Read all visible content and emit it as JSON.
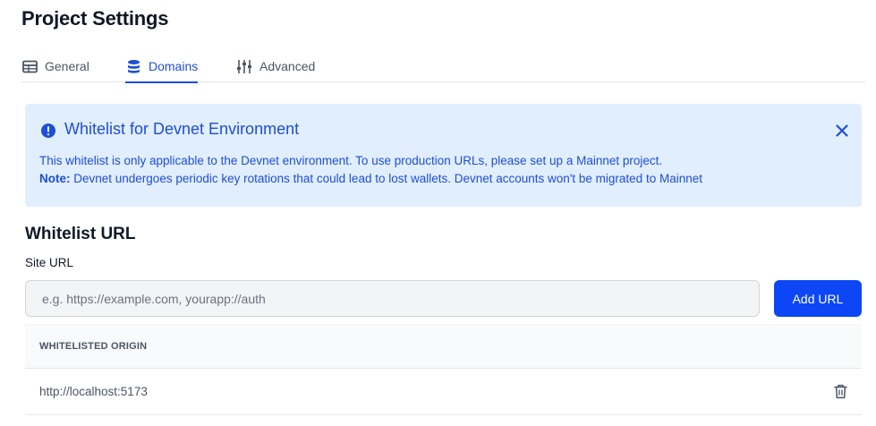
{
  "page": {
    "title": "Project Settings"
  },
  "tabs": [
    {
      "label": "General",
      "icon": "table-icon",
      "active": false
    },
    {
      "label": "Domains",
      "icon": "database-icon",
      "active": true
    },
    {
      "label": "Advanced",
      "icon": "sliders-icon",
      "active": false
    }
  ],
  "alert": {
    "title": "Whitelist for Devnet Environment",
    "line1": "This whitelist is only applicable to the Devnet environment. To use production URLs, please set up a Mainnet project.",
    "note_label": "Note:",
    "note_text": " Devnet undergoes periodic key rotations that could lead to lost wallets. Devnet accounts won't be migrated to Mainnet",
    "icon": "info-circle-icon",
    "close_icon": "close-icon"
  },
  "whitelist": {
    "section_title": "Whitelist URL",
    "field_label": "Site URL",
    "input_value": "",
    "input_placeholder": "e.g. https://example.com, yourapp://auth",
    "add_button": "Add URL",
    "column_header": "WHITELISTED ORIGIN",
    "rows": [
      {
        "origin": "http://localhost:5173"
      }
    ]
  },
  "colors": {
    "accent": "#1d4ed8",
    "button": "#0d47f5",
    "alert_bg": "#e1eefd"
  }
}
